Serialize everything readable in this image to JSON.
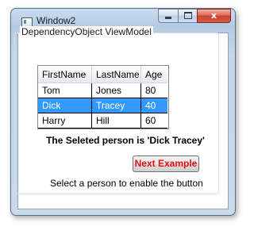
{
  "window": {
    "title": "Window2",
    "minimize_icon": "minimize-icon",
    "maximize_icon": "maximize-icon",
    "close_icon": "close-icon",
    "close_glyph": "x"
  },
  "groupbox": {
    "header": "DependencyObject ViewModel"
  },
  "grid": {
    "columns": [
      "FirstName",
      "LastName",
      "Age"
    ],
    "rows": [
      {
        "first": "Tom",
        "last": "Jones",
        "age": "80",
        "selected": false
      },
      {
        "first": "Dick",
        "last": "Tracey",
        "age": "40",
        "selected": true
      },
      {
        "first": "Harry",
        "last": "Hill",
        "age": "60",
        "selected": false
      }
    ],
    "selection_color": "#3399ff"
  },
  "selected_text": "The Seleted person is 'Dick Tracey'",
  "next_button": {
    "label": "Next Example",
    "color": "#e8100f"
  },
  "hint": "Select a person to enable the button"
}
